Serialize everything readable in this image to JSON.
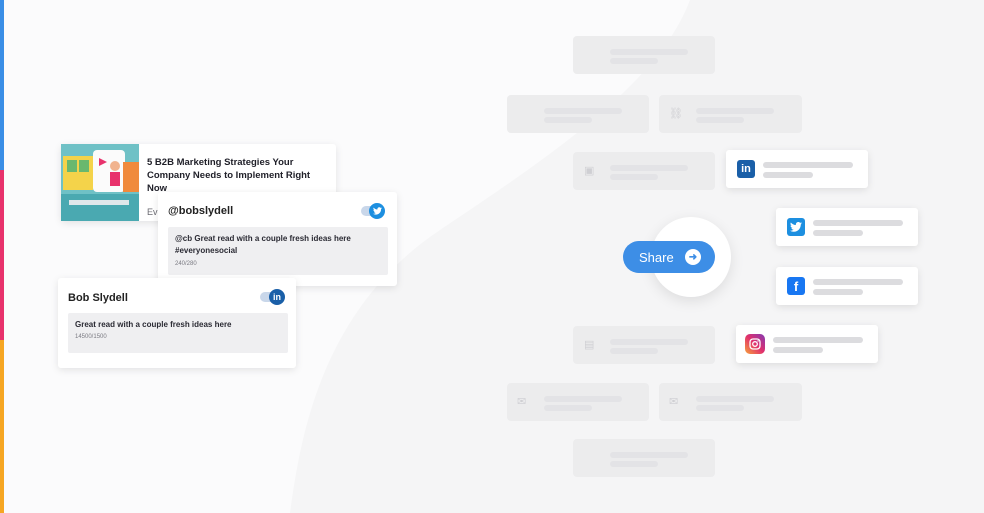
{
  "blog_card": {
    "title": "5 B2B Marketing Strategies Your Company Needs to Implement Right Now",
    "source_snippet": "Ev"
  },
  "twitter_card": {
    "handle": "@bobslydell",
    "message": "@cb Great read with a couple fresh ideas here #everyonesocial",
    "counter": "240/280",
    "icon": "twitter-icon"
  },
  "linkedin_card": {
    "name": "Bob Slydell",
    "message": "Great read with a couple fresh ideas here",
    "counter": "14500/1500",
    "icon": "linkedin-icon"
  },
  "share": {
    "label": "Share",
    "icon": "arrow-right-icon"
  },
  "networks": [
    "linkedin",
    "twitter",
    "facebook",
    "instagram"
  ],
  "colors": {
    "share_blue": "#3d8ee6",
    "linkedin": "#1a5fa8",
    "twitter": "#1d8fe0",
    "facebook": "#1877f2",
    "edge_blue": "#3a8ee6",
    "edge_pink": "#e8326c",
    "edge_orange": "#f6a623"
  }
}
